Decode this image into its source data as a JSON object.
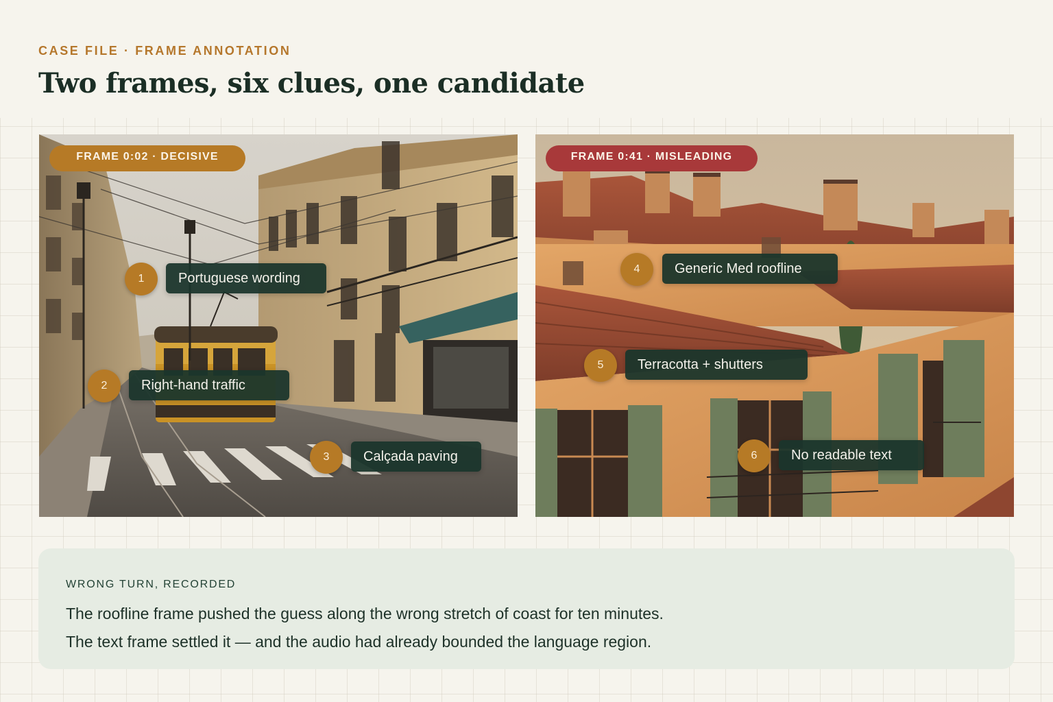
{
  "header": {
    "kicker": "CASE FILE · FRAME ANNOTATION",
    "title": "Two frames, six clues, one candidate"
  },
  "frames": [
    {
      "tag": "FRAME 0:02 · DECISIVE",
      "tag_color": "#b67a26",
      "scene": "lisbon-street-with-yellow-tram",
      "clues": [
        {
          "number": "1",
          "label": "Portuguese wording"
        },
        {
          "number": "2",
          "label": "Right-hand traffic"
        },
        {
          "number": "3",
          "label": "Calçada paving"
        }
      ]
    },
    {
      "tag": "FRAME 0:41 · MISLEADING",
      "tag_color": "#a8393a",
      "scene": "terracotta-rooftops-with-shutters",
      "clues": [
        {
          "number": "4",
          "label": "Generic Med roofline"
        },
        {
          "number": "5",
          "label": "Terracotta + shutters"
        },
        {
          "number": "6",
          "label": "No readable text"
        }
      ]
    }
  ],
  "note": {
    "kicker": "WRONG TURN, RECORDED",
    "lines": [
      "The roofline frame pushed the guess along the wrong stretch of coast for ten minutes.",
      "The text frame settled it — and the audio had already bounded the language region."
    ]
  },
  "colors": {
    "accent_gold": "#b67a26",
    "accent_red": "#a8393a",
    "label_green": "#1b352c",
    "panel_bg": "#e6ece3",
    "page_bg": "#f6f4ed"
  }
}
